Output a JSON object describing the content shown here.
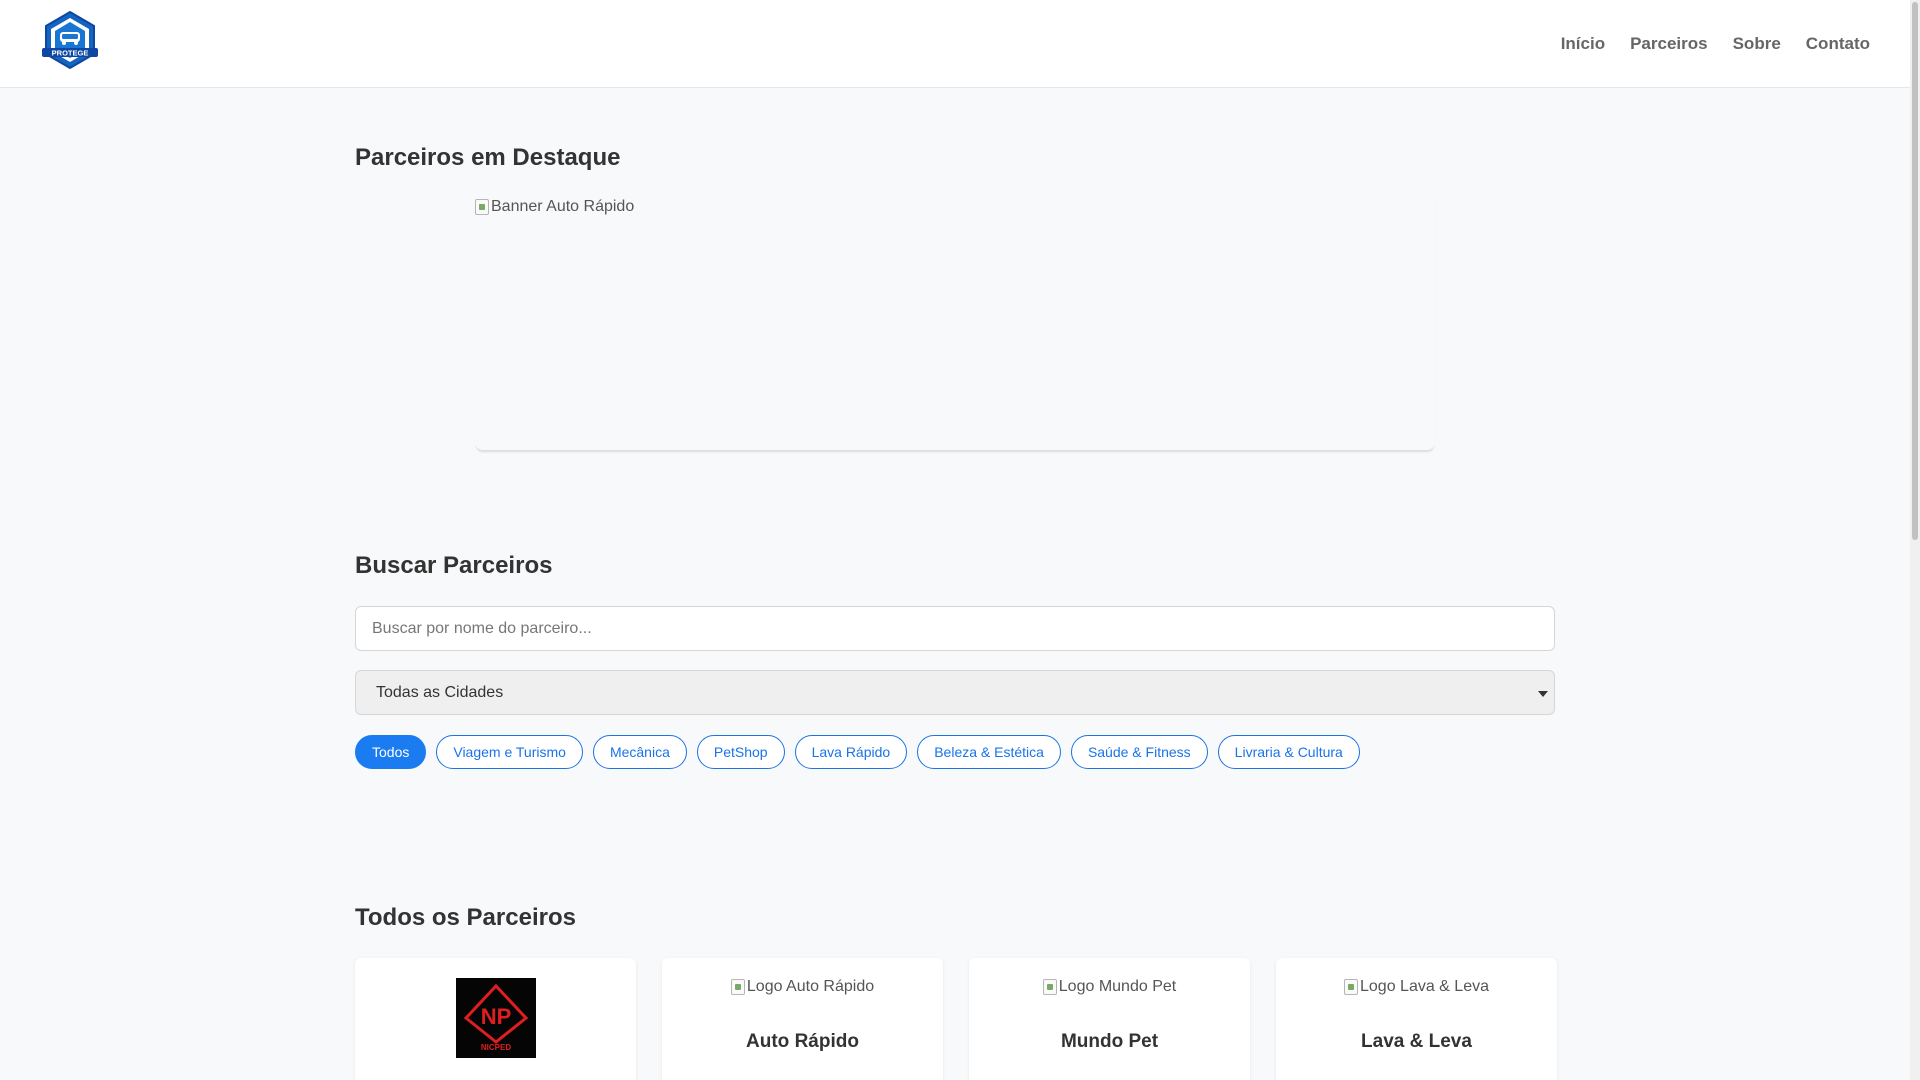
{
  "header": {
    "logo_text": "PROTEGE",
    "nav": [
      "Início",
      "Parceiros",
      "Sobre",
      "Contato"
    ]
  },
  "featured": {
    "title": "Parceiros em Destaque",
    "banner_alt": "Banner Auto Rápido"
  },
  "search": {
    "title": "Buscar Parceiros",
    "placeholder": "Buscar por nome do parceiro...",
    "city_selected": "Todas as Cidades",
    "categories": [
      "Todos",
      "Viagem e Turismo",
      "Mecânica",
      "PetShop",
      "Lava Rápido",
      "Beleza & Estética",
      "Saúde & Fitness",
      "Livraria & Cultura"
    ],
    "active_category": "Todos"
  },
  "all_partners": {
    "title": "Todos os Parceiros",
    "cards": [
      {
        "logo_alt": "",
        "logo_text": "NICPED",
        "name": ""
      },
      {
        "logo_alt": "Logo Auto Rápido",
        "name": "Auto Rápido"
      },
      {
        "logo_alt": "Logo Mundo Pet",
        "name": "Mundo Pet"
      },
      {
        "logo_alt": "Logo Lava & Leva",
        "name": "Lava & Leva"
      }
    ]
  },
  "colors": {
    "accent": "#1a7cf0",
    "logo_blue": "#1565c0",
    "nicped_red": "#e01e1e"
  }
}
